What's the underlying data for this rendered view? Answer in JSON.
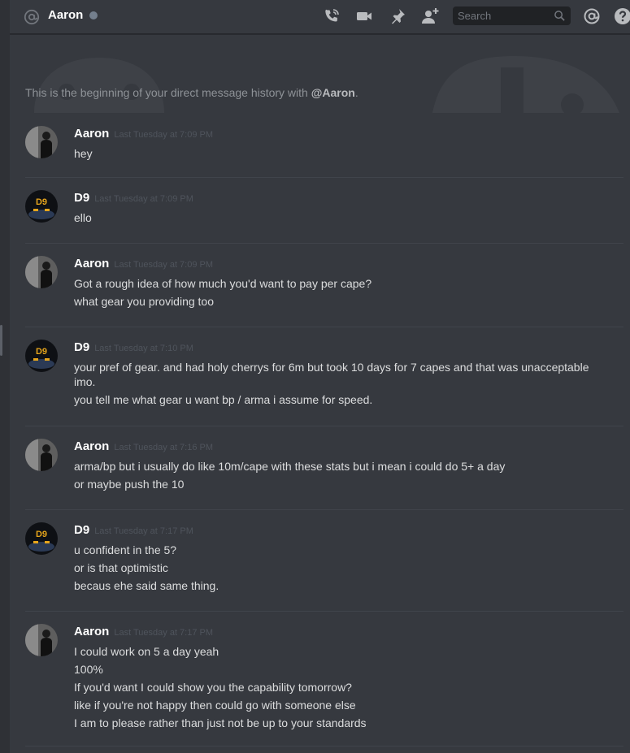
{
  "header": {
    "channel_name": "Aaron",
    "status": "offline",
    "search_placeholder": "Search",
    "icons": [
      "at-icon",
      "call-icon",
      "video-icon",
      "pin-icon",
      "add-friend-icon",
      "search-icon",
      "mentions-icon",
      "help-icon"
    ]
  },
  "intro": {
    "prefix": "This is the beginning of your direct message history with ",
    "handle": "@Aaron",
    "suffix": "."
  },
  "messages": [
    {
      "author": "Aaron",
      "timestamp": "Last Tuesday at 7:09 PM",
      "lines": [
        "hey"
      ]
    },
    {
      "author": "D9",
      "timestamp": "Last Tuesday at 7:09 PM",
      "lines": [
        "ello"
      ]
    },
    {
      "author": "Aaron",
      "timestamp": "Last Tuesday at 7:09 PM",
      "lines": [
        "Got a rough idea of how much you'd want to pay per cape?",
        "what gear you providing too"
      ]
    },
    {
      "author": "D9",
      "timestamp": "Last Tuesday at 7:10 PM",
      "lines": [
        "your pref of gear. and had holy cherrys for 6m but took 10 days for 7 capes and that was unacceptable imo.",
        "you tell me what gear u want bp / arma i assume for speed."
      ]
    },
    {
      "author": "Aaron",
      "timestamp": "Last Tuesday at 7:16 PM",
      "lines": [
        "arma/bp but i usually do like 10m/cape with these stats but i mean i could do 5+ a day",
        "or maybe push the 10"
      ]
    },
    {
      "author": "D9",
      "timestamp": "Last Tuesday at 7:17 PM",
      "lines": [
        "u confident in the 5?",
        "or is that optimistic",
        "becaus ehe said same thing."
      ]
    },
    {
      "author": "Aaron",
      "timestamp": "Last Tuesday at 7:17 PM",
      "lines": [
        "I could work on 5 a day yeah",
        "100%",
        "If you'd want I could show you the capability tomorrow?",
        "like if you're not happy then could go with someone else",
        "I am to please rather than just not be up to your standards"
      ]
    }
  ],
  "colors": {
    "background": "#36393f",
    "author": "#ffffff",
    "timestamp": "#4f545c",
    "message_text": "#dcddde",
    "divider": "#40444b"
  }
}
